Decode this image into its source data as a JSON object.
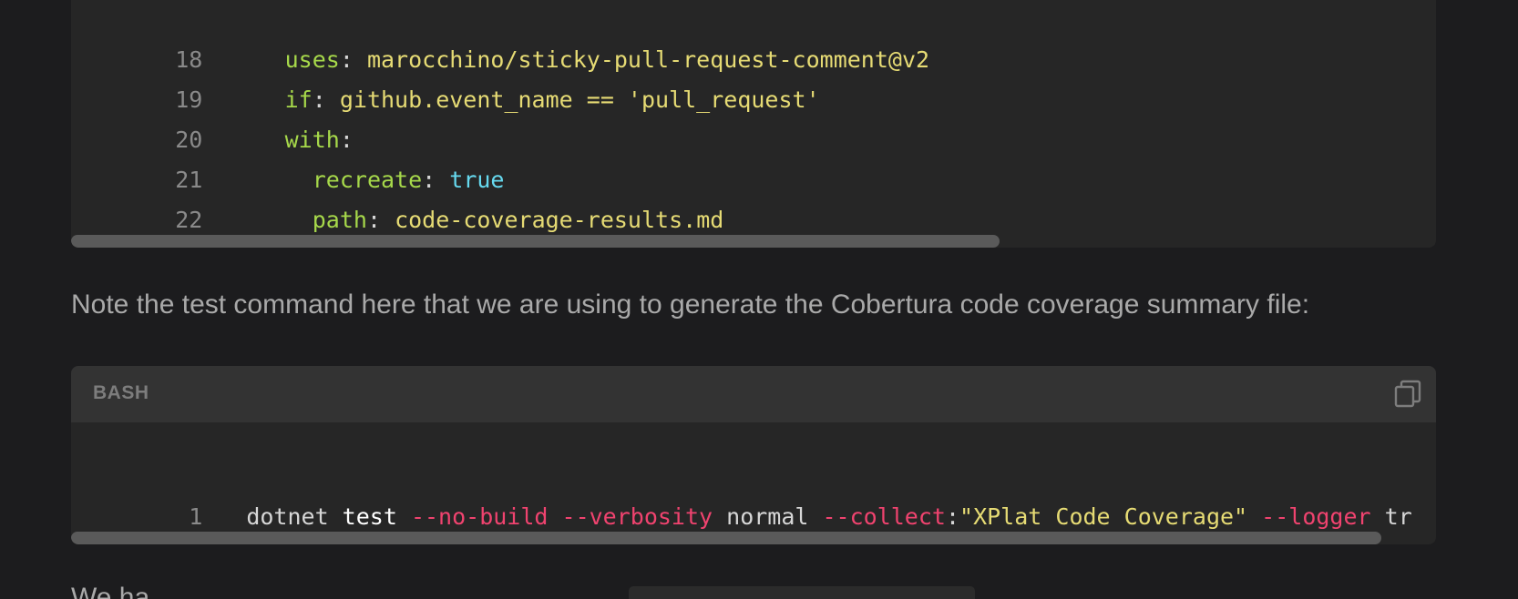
{
  "yaml_block": {
    "lines": [
      {
        "num": "18",
        "indent": "      ",
        "key": "uses",
        "sep": ": ",
        "value": "marocchino/sticky-pull-request-comment@v2",
        "value_kind": "string"
      },
      {
        "num": "19",
        "indent": "      ",
        "key": "if",
        "sep": ": ",
        "value": "github.event_name == 'pull_request'",
        "value_kind": "string"
      },
      {
        "num": "20",
        "indent": "      ",
        "key": "with",
        "sep": ":",
        "value": "",
        "value_kind": "string"
      },
      {
        "num": "21",
        "indent": "        ",
        "key": "recreate",
        "sep": ": ",
        "value": "true",
        "value_kind": "boolean"
      },
      {
        "num": "22",
        "indent": "        ",
        "key": "path",
        "sep": ": ",
        "value": "code-coverage-results.md",
        "value_kind": "string"
      }
    ],
    "scroll_fraction": 0.68
  },
  "paragraph": "Note the test command here that we are using to generate the Cobertura code coverage summary file:",
  "bash_block": {
    "language": "BASH",
    "copy_icon": "copy-icon",
    "line_num": "1",
    "tokens": [
      {
        "text": "dotnet ",
        "kind": "cmd"
      },
      {
        "text": "test ",
        "kind": "sub"
      },
      {
        "text": "--no-build ",
        "kind": "flag"
      },
      {
        "text": "--verbosity ",
        "kind": "flag"
      },
      {
        "text": "normal ",
        "kind": "arg"
      },
      {
        "text": "--collect",
        "kind": "flag"
      },
      {
        "text": ":",
        "kind": "arg"
      },
      {
        "text": "\"XPlat Code Coverage\"",
        "kind": "str"
      },
      {
        "text": " ",
        "kind": "arg"
      },
      {
        "text": "--logger ",
        "kind": "flag"
      },
      {
        "text": "tr",
        "kind": "arg"
      }
    ],
    "scroll_fraction": 0.96
  },
  "bottom_paragraph": "We ha"
}
